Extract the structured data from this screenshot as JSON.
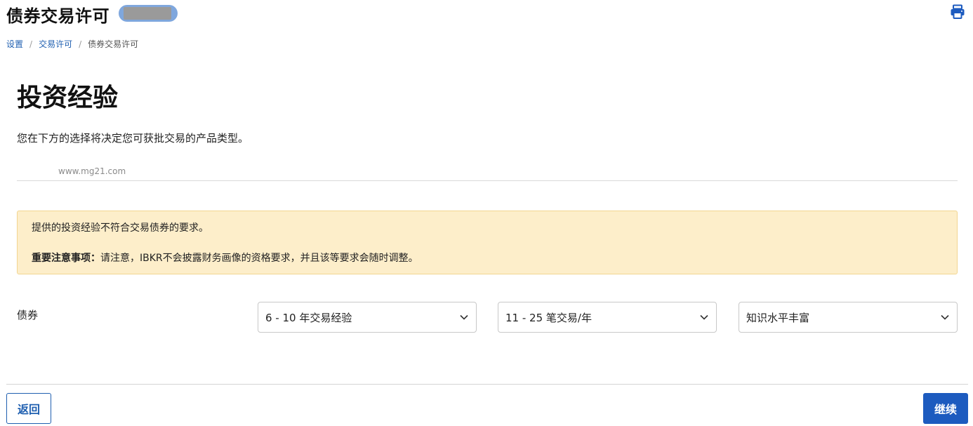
{
  "header": {
    "title": "债券交易许可",
    "account_badge": "redacted-account",
    "print_icon": "printer-icon"
  },
  "breadcrumb": {
    "items": [
      "设置",
      "交易许可",
      "债券交易许可"
    ],
    "separator": "/"
  },
  "section": {
    "title": "投资经验",
    "description": "您在下方的选择将决定您可获批交易的产品类型。",
    "watermark": "www.mg21.com"
  },
  "warning": {
    "line1": "提供的投资经验不符合交易债券的要求。",
    "line2_bold": "重要注意事项：",
    "line2_rest": "请注意，IBKR不会披露财务画像的资格要求，并且该等要求会随时调整。"
  },
  "experience_row": {
    "label": "债券",
    "years_select": "6 - 10 年交易经验",
    "trades_select": "11 - 25 笔交易/年",
    "knowledge_select": "知识水平丰富"
  },
  "footer": {
    "back_label": "返回",
    "continue_label": "继续"
  },
  "colors": {
    "primary": "#1d5bbf",
    "link": "#1f5fb0",
    "warning_bg": "#fdeeca",
    "warning_border": "#f2d590"
  }
}
